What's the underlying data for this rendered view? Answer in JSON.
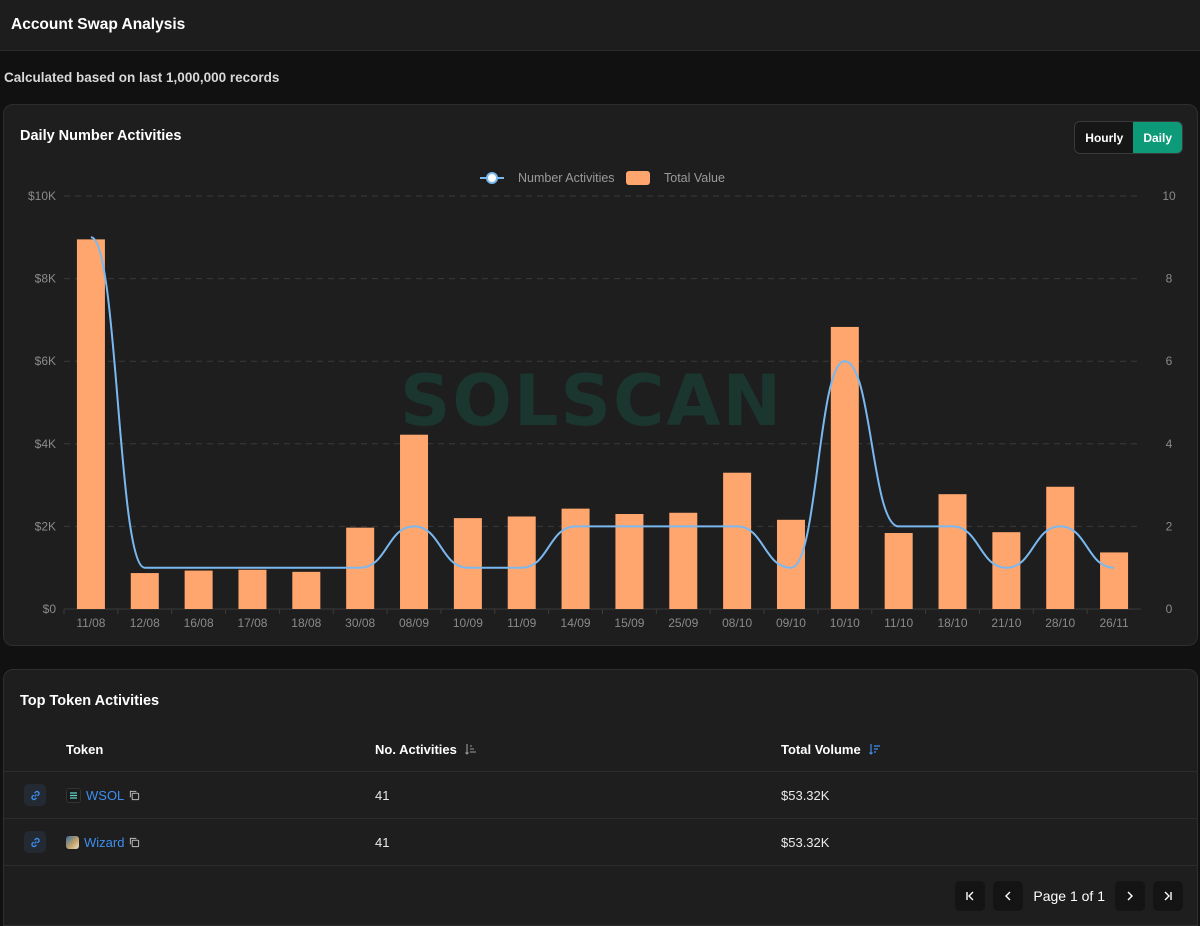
{
  "header": {
    "title": "Account Swap Analysis"
  },
  "subtitle": "Calculated based on last 1,000,000 records",
  "chart_card": {
    "title": "Daily Number Activities",
    "toggle": {
      "hourly": "Hourly",
      "daily": "Daily",
      "active": "daily"
    },
    "watermark": "SOLSCAN"
  },
  "chart_data": {
    "type": "bar",
    "categories": [
      "11/08",
      "12/08",
      "16/08",
      "17/08",
      "18/08",
      "30/08",
      "08/09",
      "10/09",
      "11/09",
      "14/09",
      "15/09",
      "25/09",
      "08/10",
      "09/10",
      "10/10",
      "11/10",
      "18/10",
      "21/10",
      "28/10",
      "26/11"
    ],
    "series": [
      {
        "name": "Total Value",
        "type": "bar",
        "axis": "left",
        "color": "#ffa66e",
        "values": [
          8950,
          870,
          930,
          950,
          900,
          1970,
          4220,
          2200,
          2240,
          2430,
          2300,
          2330,
          3300,
          2160,
          6830,
          1840,
          2780,
          1860,
          2960,
          1370
        ]
      },
      {
        "name": "Number Activities",
        "type": "line",
        "axis": "right",
        "color": "#7ab8f0",
        "values": [
          9,
          1,
          1,
          1,
          1,
          1,
          2,
          1,
          1,
          2,
          2,
          2,
          2,
          1,
          6,
          2,
          2,
          1,
          2,
          1
        ]
      }
    ],
    "y_left": {
      "ticks": [
        "$0",
        "$2K",
        "$4K",
        "$6K",
        "$8K",
        "$10K"
      ],
      "range": [
        0,
        10000
      ]
    },
    "y_right": {
      "ticks": [
        "0",
        "2",
        "4",
        "6",
        "8",
        "10"
      ],
      "range": [
        0,
        10
      ]
    },
    "legend": [
      "Number Activities",
      "Total Value"
    ],
    "legend_position": "top-center",
    "grid": true
  },
  "token_card": {
    "title": "Top Token Activities",
    "columns": {
      "token": "Token",
      "activities": "No. Activities",
      "volume": "Total Volume"
    },
    "rows": [
      {
        "token": "WSOL",
        "activities": "41",
        "volume": "$53.32K",
        "logo_color": "#1a1a1a"
      },
      {
        "token": "Wizard",
        "activities": "41",
        "volume": "$53.32K",
        "logo_color": "#5a8fb8"
      }
    ],
    "pagination": {
      "label": "Page 1 of 1"
    }
  },
  "colors": {
    "accent": "#0d9a78",
    "link": "#3d8ef0",
    "bar": "#ffa66e",
    "line": "#7ab8f0"
  }
}
